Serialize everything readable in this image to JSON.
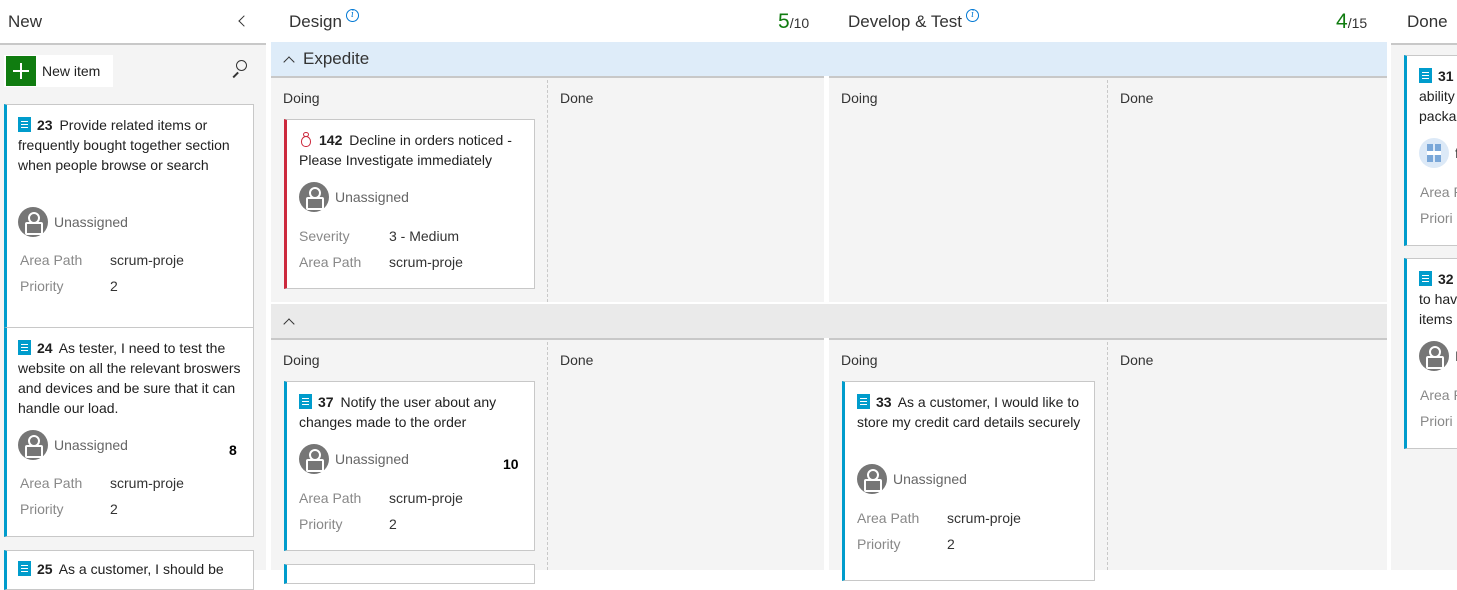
{
  "columns": {
    "new": {
      "title": "New",
      "add_label": "New item"
    },
    "design": {
      "title": "Design",
      "wip_current": "5",
      "wip_limit": "/10"
    },
    "develop": {
      "title": "Develop & Test",
      "wip_current": "4",
      "wip_limit": "/15"
    },
    "done": {
      "title": "Done"
    }
  },
  "swimlanes": {
    "expedite": {
      "title": "Expedite"
    },
    "default": {
      "title": ""
    }
  },
  "sub_columns": {
    "doing": "Doing",
    "done": "Done"
  },
  "labels": {
    "unassigned": "Unassigned",
    "area_path": "Area Path",
    "priority": "Priority",
    "severity": "Severity",
    "area_path_short": "Area P",
    "priority_short": "Priori"
  },
  "cards": {
    "c23": {
      "id": "23",
      "title": "Provide related items or frequently bought together section when people browse or search",
      "area": "scrum-proje",
      "priority": "2"
    },
    "c24": {
      "id": "24",
      "title": "As tester, I need to test the website on all the relevant broswers and devices and be sure that it can handle our load.",
      "effort": "8",
      "area": "scrum-proje",
      "priority": "2"
    },
    "c25": {
      "id": "25",
      "title": "As a customer, I should be"
    },
    "c142": {
      "id": "142",
      "title": "Decline in orders noticed - Please Investigate immediately",
      "severity": "3 - Medium",
      "area": "scrum-proje"
    },
    "c37": {
      "id": "37",
      "title": "Notify the user about any changes made to the order",
      "effort": "10",
      "area": "scrum-proje",
      "priority": "2"
    },
    "c33": {
      "id": "33",
      "title": "As a customer, I would like to store my credit card details securely",
      "area": "scrum-proje",
      "priority": "2"
    },
    "c31": {
      "id": "31",
      "line1": "ability",
      "line2": "packag",
      "assignee_initial": "f"
    },
    "c32": {
      "id": "32",
      "line1": "to hav",
      "line2": "items",
      "assignee_initial": "I"
    }
  },
  "colors": {
    "story": "#009ccc",
    "bug": "#cc293d",
    "wip_ok": "#107c10",
    "add": "#107c10",
    "expedite_bg": "#deecf9"
  }
}
